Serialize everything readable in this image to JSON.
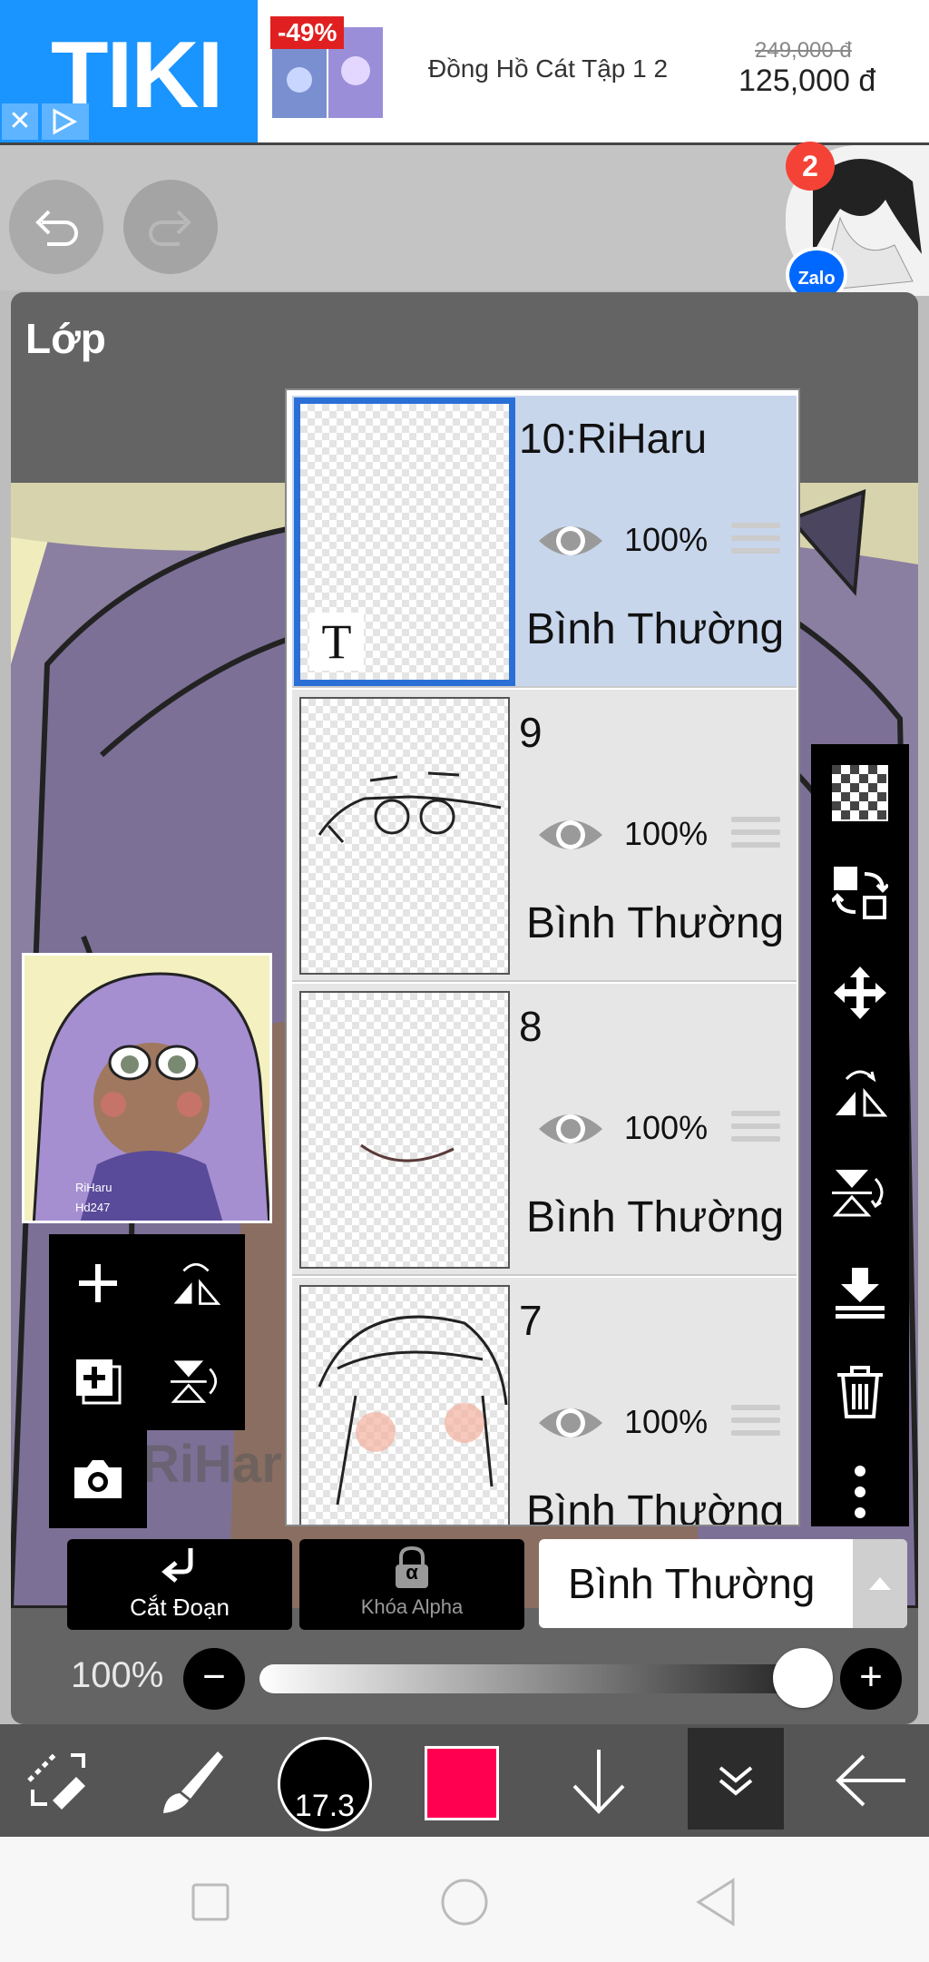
{
  "ad": {
    "brand": "TIKI",
    "discount": "-49%",
    "product_title": "Đồng Hồ Cát Tập 1 2",
    "old_price": "249,000 đ",
    "new_price": "125,000 đ",
    "close_symbol": "✕"
  },
  "notification": {
    "badge_count": "2",
    "app": "Zalo"
  },
  "panel": {
    "title": "Lớp"
  },
  "layers": [
    {
      "name": "10:RiHaru",
      "opacity": "100%",
      "blend": "Bình Thường",
      "selected": true
    },
    {
      "name": "9",
      "opacity": "100%",
      "blend": "Bình Thường",
      "selected": false
    },
    {
      "name": "8",
      "opacity": "100%",
      "blend": "Bình Thường",
      "selected": false
    },
    {
      "name": "7",
      "opacity": "100%",
      "blend": "Bình Thường",
      "selected": false
    }
  ],
  "text_layer_glyph": "T",
  "preview": {
    "watermark_line1": "RiHaru",
    "watermark_line2": "Hd247"
  },
  "canvas_watermark": "RiHaru",
  "actions": {
    "clipping_label": "Cắt Đoạn",
    "alpha_lock_label": "Khóa Alpha",
    "alpha_symbol": "α",
    "blend_mode_selected": "Bình Thường"
  },
  "opacity_slider": {
    "label": "100%",
    "value": 1.0
  },
  "bottom_toolbar": {
    "brush_size": "17.3",
    "color": "#ff0050"
  },
  "colors": {
    "selected_layer_bg": "#c8d6ec",
    "selected_border": "#2a6fd6",
    "tiki_blue": "#1a94ff",
    "zalo_blue": "#0068ff",
    "badge_red": "#f44336"
  }
}
